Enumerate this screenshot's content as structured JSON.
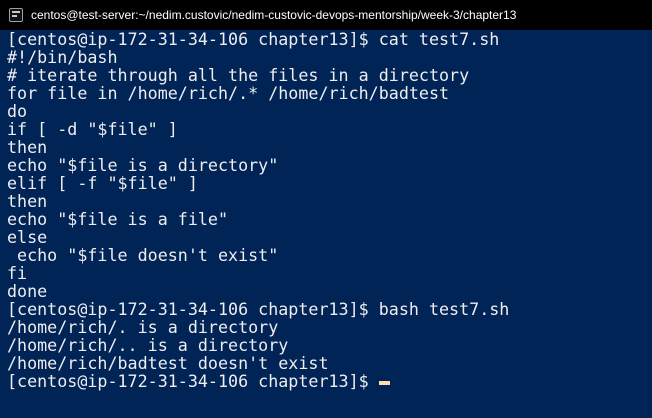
{
  "window": {
    "title": "centos@test-server:~/nedim.custovic/nedim-custovic-devops-mentorship/week-3/chapter13"
  },
  "terminal": {
    "lines": [
      "[centos@ip-172-31-34-106 chapter13]$ cat test7.sh",
      "#!/bin/bash",
      "# iterate through all the files in a directory",
      "for file in /home/rich/.* /home/rich/badtest",
      "do",
      "if [ -d \"$file\" ]",
      "then",
      "echo \"$file is a directory\"",
      "elif [ -f \"$file\" ]",
      "then",
      "echo \"$file is a file\"",
      "else",
      " echo \"$file doesn't exist\"",
      "fi",
      "done",
      "[centos@ip-172-31-34-106 chapter13]$ bash test7.sh",
      "/home/rich/. is a directory",
      "/home/rich/.. is a directory",
      "/home/rich/badtest doesn't exist"
    ],
    "prompt": "[centos@ip-172-31-34-106 chapter13]$"
  },
  "colors": {
    "background": "#012456",
    "text": "#eeedf0",
    "cursor": "#fedba9",
    "titlebar": "#000000"
  }
}
